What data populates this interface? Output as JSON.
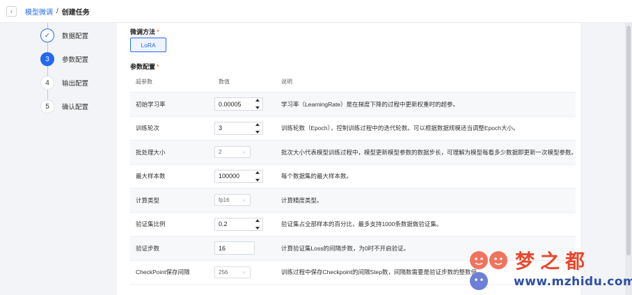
{
  "breadcrumb": {
    "back": "‹",
    "parent": "模型微调",
    "sep": "/",
    "current": "创建任务"
  },
  "steps": [
    {
      "num": "✓",
      "label": "数据配置",
      "state": "done"
    },
    {
      "num": "3",
      "label": "参数配置",
      "state": "active"
    },
    {
      "num": "4",
      "label": "输出配置",
      "state": "todo"
    },
    {
      "num": "5",
      "label": "确认配置",
      "state": "todo"
    }
  ],
  "method": {
    "title": "微调方法",
    "required": "*",
    "option": "LoRA"
  },
  "params": {
    "title": "参数配置",
    "required": "*",
    "headers": [
      "超参数",
      "数值",
      "说明"
    ],
    "rows": [
      {
        "name": "初始学习率",
        "value": "0.00005",
        "control": "stepper",
        "desc": "学习率（LearningRate）是在梯度下降的过程中更新权重时的超参。"
      },
      {
        "name": "训练轮次",
        "value": "3",
        "control": "stepper",
        "desc": "训练轮数（Epoch），控制训练过程中的迭代轮数。可以根据数据规模适当调整Epoch大小。"
      },
      {
        "name": "批处理大小",
        "value": "2",
        "control": "select",
        "desc": "批次大小代表模型训练过程中，模型更新模型参数的数据步长，可理解为模型每看多少数据即更新一次模型参数。"
      },
      {
        "name": "最大样本数",
        "value": "100000",
        "control": "stepper",
        "desc": "每个数据集的最大样本数。"
      },
      {
        "name": "计算类型",
        "value": "fp16",
        "control": "select",
        "desc": "计算精度类型。"
      },
      {
        "name": "验证集比例",
        "value": "0.2",
        "control": "stepper",
        "desc": "验证集占全部样本的百分比，最多支持1000条数据做验证集。"
      },
      {
        "name": "验证步数",
        "value": "16",
        "control": "input",
        "desc": "计算验证集Loss的间隔步数，为0时不开启验证。"
      },
      {
        "name": "CheckPoint保存间隔",
        "value": "256",
        "control": "select",
        "desc": "训练过程中保存Checkpoint的间隔Step数，间隔数需要是验证步数的整数倍"
      }
    ]
  },
  "watermark": {
    "cn": "梦之都",
    "en": "www.mzhidu.com"
  },
  "colors": {
    "accent": "#2468f2",
    "required": "#e8482f"
  }
}
